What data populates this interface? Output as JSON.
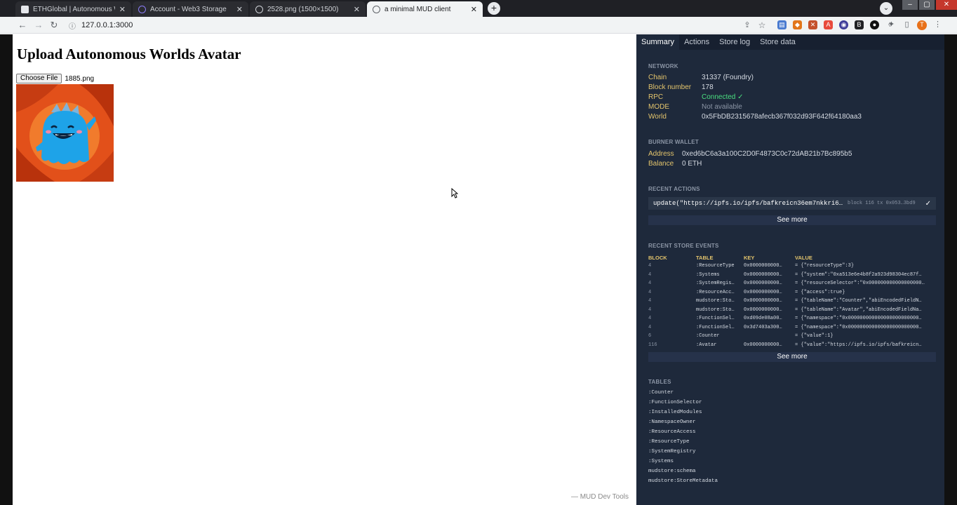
{
  "browser": {
    "tabs": [
      {
        "title": "ETHGlobal | Autonomous Wor",
        "active": false
      },
      {
        "title": "Account - Web3 Storage",
        "active": false
      },
      {
        "title": "2528.png (1500×1500)",
        "active": false
      },
      {
        "title": "a minimal MUD client",
        "active": true
      }
    ],
    "url": "127.0.0.1:3000"
  },
  "page": {
    "heading": "Upload Autonomous Worlds Avatar",
    "choose_file_label": "Choose File",
    "file_name": "1885.png",
    "footer": "— MUD Dev Tools"
  },
  "devtools": {
    "tabs": [
      "Summary",
      "Actions",
      "Store log",
      "Store data"
    ],
    "network": {
      "heading": "NETWORK",
      "rows": [
        {
          "k": "Chain",
          "v": "31337 (Foundry)",
          "style": ""
        },
        {
          "k": "Block number",
          "v": "178",
          "style": ""
        },
        {
          "k": "RPC",
          "v": "Connected ✓",
          "style": "ok"
        },
        {
          "k": "MODE",
          "v": "Not available",
          "style": "muted"
        },
        {
          "k": "World",
          "v": "0x5FbDB2315678afecb367f032d93F642f64180aa3",
          "style": ""
        }
      ]
    },
    "burner": {
      "heading": "BURNER WALLET",
      "rows": [
        {
          "k": "Address",
          "v": "0xed6bC6a3a100C2D0F4873C0c72dAB21b7Bc895b5"
        },
        {
          "k": "Balance",
          "v": "0 ETH"
        }
      ]
    },
    "recent_actions": {
      "heading": "RECENT ACTIONS",
      "call": "update(\"https://ipfs.io/ipfs/bafkreicn36em7nkkri6…",
      "meta": "block 116  tx 0x053…3bd9",
      "check": "✓",
      "see_more": "See more"
    },
    "store_events": {
      "heading": "RECENT STORE EVENTS",
      "columns": [
        "BLOCK",
        "TABLE",
        "KEY",
        "VALUE"
      ],
      "rows": [
        [
          "4",
          ":ResourceType",
          "0x0000000000…",
          "= {\"resourceType\":3}"
        ],
        [
          "4",
          ":Systems",
          "0x0000000000…",
          "= {\"system\":\"0xa513e6e4b8f2a923d98304ec87f…"
        ],
        [
          "4",
          ":SystemRegis…",
          "0x0000000000…",
          "= {\"resourceSelector\":\"0x000000000000000000…"
        ],
        [
          "4",
          ":ResourceAcc…",
          "0x0000000000…",
          "= {\"access\":true}"
        ],
        [
          "4",
          "mudstore:Sto…",
          "0x0000000000…",
          "= {\"tableName\":\"Counter\",\"abiEncodedFieldN…"
        ],
        [
          "4",
          "mudstore:Sto…",
          "0x0000000000…",
          "= {\"tableName\":\"Avatar\",\"abiEncodedFieldNa…"
        ],
        [
          "4",
          ":FunctionSel…",
          "0xd09de08a00…",
          "= {\"namespace\":\"0x000000000000000000000000…"
        ],
        [
          "4",
          ":FunctionSel…",
          "0x3d7403a300…",
          "= {\"namespace\":\"0x000000000000000000000000…"
        ],
        [
          "6",
          ":Counter",
          "",
          "= {\"value\":1}"
        ],
        [
          "116",
          ":Avatar",
          "0x0000000000…",
          "= {\"value\":\"https://ipfs.io/ipfs/bafkreicn…"
        ]
      ],
      "see_more": "See more"
    },
    "tables": {
      "heading": "TABLES",
      "items": [
        ":Counter",
        ":FunctionSelector",
        ":InstalledModules",
        ":NamespaceOwner",
        ":ResourceAccess",
        ":ResourceType",
        ":SystemRegistry",
        ":Systems",
        "mudstore:schema",
        "mudstore:StoreMetadata"
      ]
    }
  },
  "colors": {
    "devtools_bg": "#1e293b",
    "key_yellow": "#e3c46c",
    "connected_green": "#4ade80"
  },
  "icons": [
    "back-arrow-icon",
    "forward-arrow-icon",
    "reload-icon",
    "info-icon",
    "share-icon",
    "star-icon",
    "extensions-icon",
    "mouse-cursor-icon"
  ]
}
